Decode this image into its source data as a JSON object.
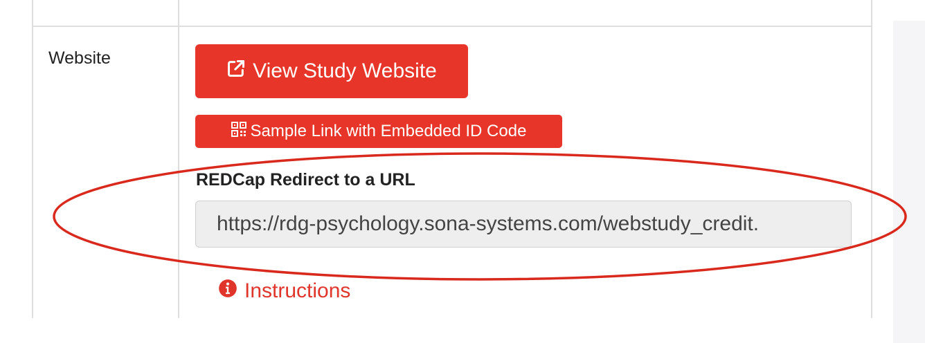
{
  "row": {
    "label": "Website"
  },
  "buttons": {
    "view_study_website": "View Study Website",
    "sample_link": "Sample Link with Embedded ID Code"
  },
  "redirect": {
    "label": "REDCap Redirect to a URL",
    "url_value": "https://rdg-psychology.sona-systems.com/webstudy_credit."
  },
  "instructions": {
    "label": "Instructions"
  },
  "icons": {
    "external_link": "external-link-icon",
    "qr_code": "qr-code-icon",
    "info": "info-circle-icon"
  },
  "colors": {
    "accent": "#e8352a",
    "annotation": "#d9281c",
    "input_bg": "#eeeeee"
  }
}
